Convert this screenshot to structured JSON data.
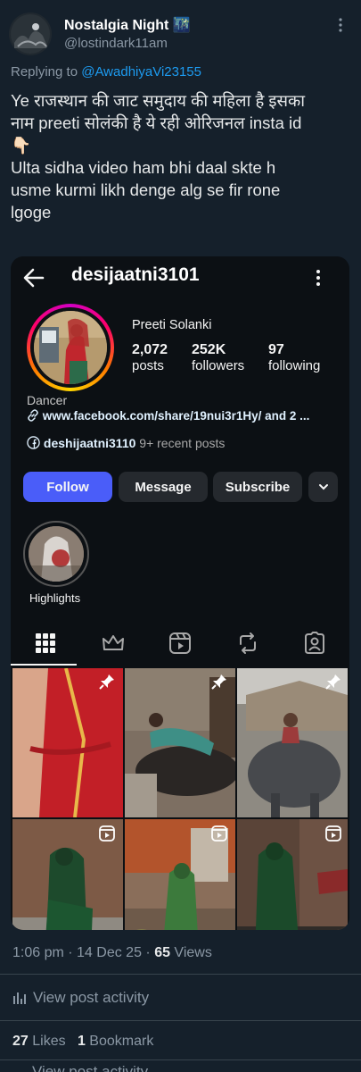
{
  "tweet": {
    "display_name": "Nostalgia Night",
    "name_emoji": "🌃",
    "handle": "@lostindark11am",
    "replying_prefix": "Replying to ",
    "replying_to": "@AwadhiyaVi23155",
    "text_lines": [
      "Ye राजस्थान की जाट समुदाय की महिला है इसका",
      "नाम preeti सोलंकी है ये रही ओरिजनल insta id",
      "👇🏻",
      "Ulta sidha video ham bhi daal skte h",
      "usme kurmi likh denge alg se fir rone",
      "lgoge"
    ]
  },
  "instagram": {
    "username": "desijaatni3101",
    "full_name": "Preeti Solanki",
    "stats": [
      {
        "value": "2,072",
        "label": "posts"
      },
      {
        "value": "252K",
        "label": "followers"
      },
      {
        "value": "97",
        "label": "following"
      }
    ],
    "category": "Dancer",
    "link": "www.facebook.com/share/19nui3r1Hy/ and 2 ...",
    "fb_handle": "deshijaatni3110",
    "fb_recent": "9+ recent posts",
    "buttons": {
      "follow": "Follow",
      "message": "Message",
      "subscribe": "Subscribe"
    },
    "highlight_label": "Highlights",
    "tabs": [
      "grid-icon",
      "crown-icon",
      "reels-icon",
      "repost-icon",
      "tagged-icon"
    ],
    "colors": {
      "follow_button": "#4a5df9",
      "background": "#0c1014"
    }
  },
  "meta": {
    "time": "1:06 pm · 14 Dec 25 · ",
    "views_count": "65",
    "views_label": " Views",
    "activity": "View post activity",
    "likes_count": "27",
    "likes_label": " Likes",
    "bookmarks_count": "1",
    "bookmarks_label": " Bookmark",
    "cutoff_text": "View post activity"
  },
  "colors": {
    "background": "#15202b",
    "link": "#1d9bf0",
    "muted": "#8b98a5"
  }
}
